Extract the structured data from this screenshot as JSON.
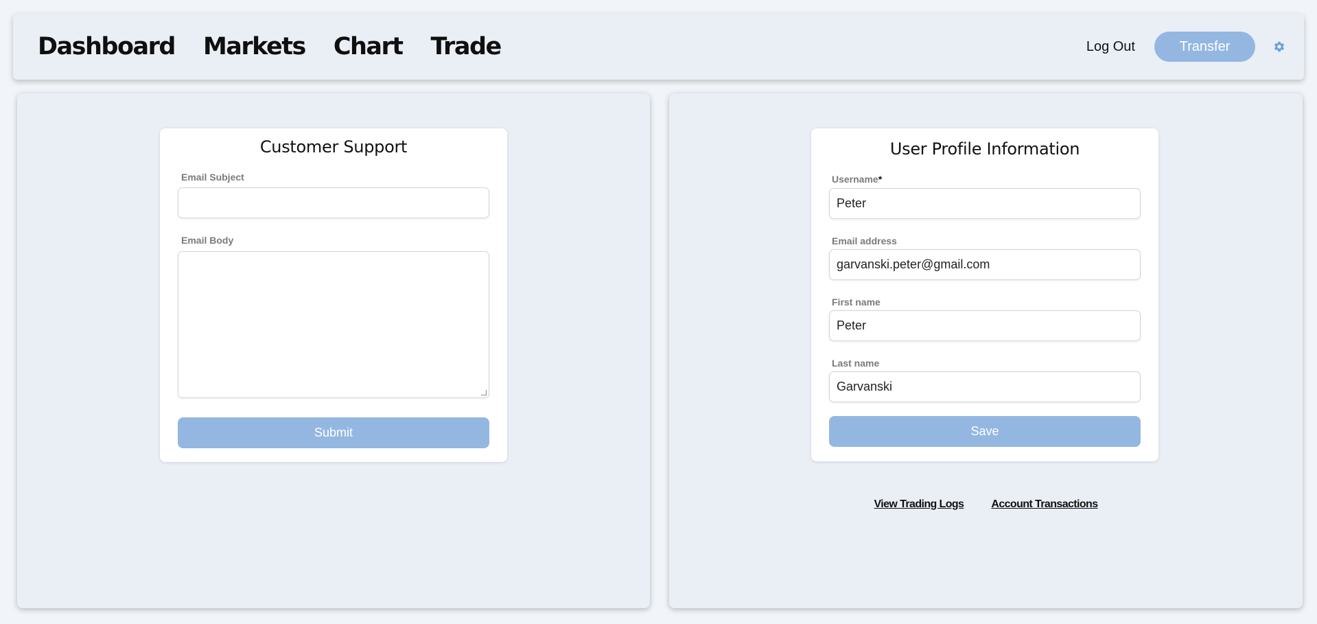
{
  "nav": {
    "items": [
      "Dashboard",
      "Markets",
      "Chart",
      "Trade"
    ],
    "logout_label": "Log Out",
    "transfer_label": "Transfer",
    "settings_icon": "gear-icon"
  },
  "support": {
    "title": "Customer Support",
    "subject_label": "Email Subject",
    "subject_value": "",
    "body_label": "Email Body",
    "body_value": "",
    "submit_label": "Submit"
  },
  "profile": {
    "title": "User Profile Information",
    "username_label": "Username",
    "username_required": "*",
    "username_value": "Peter",
    "email_label": "Email address",
    "email_value": "garvanski.peter@gmail.com",
    "first_name_label": "First name",
    "first_name_value": "Peter",
    "last_name_label": "Last name",
    "last_name_value": "Garvanski",
    "save_label": "Save"
  },
  "links": {
    "trading_logs": "View Trading Logs",
    "account_transactions": "Account Transactions"
  },
  "colors": {
    "accent": "#94b7e2",
    "background": "#eaeff6",
    "gear": "#6d9fde"
  }
}
